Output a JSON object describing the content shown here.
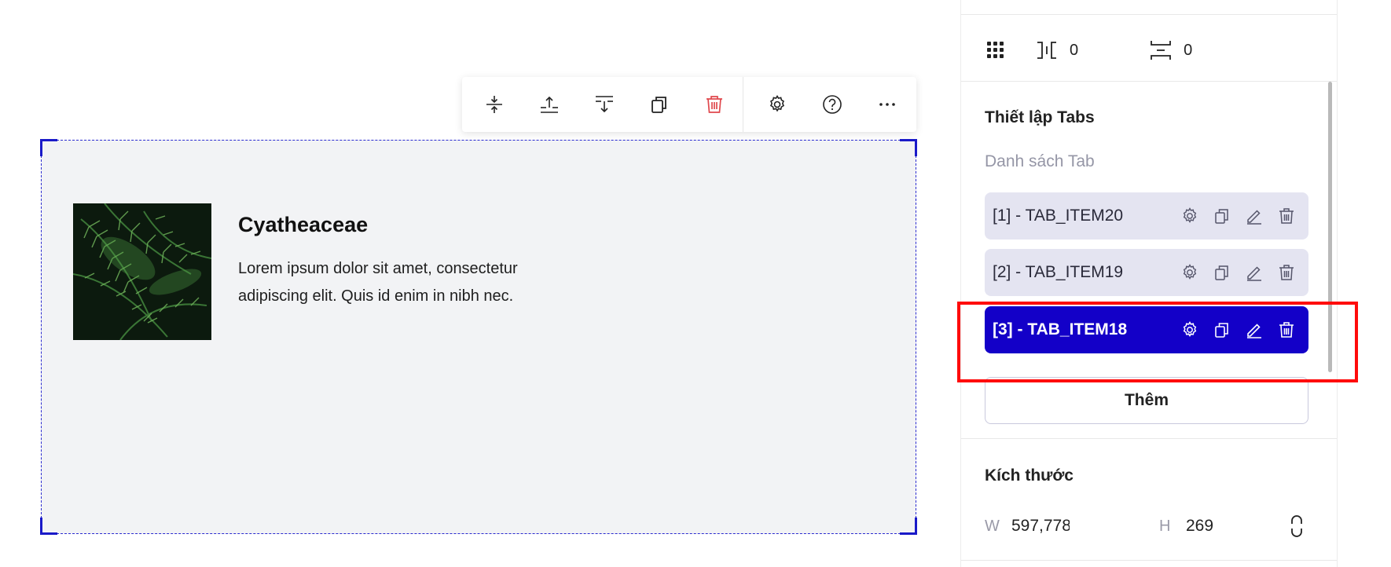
{
  "toolbar": {
    "left_buttons": [
      "move-icon",
      "insert-above-icon",
      "insert-below-icon",
      "duplicate-icon",
      "delete-icon"
    ],
    "right_buttons": [
      "settings-icon",
      "help-icon",
      "more-icon"
    ],
    "delete_color": "#e0484d"
  },
  "card": {
    "title": "Cyatheaceae",
    "text_line1": "Lorem ipsum dolor sit amet, consectetur",
    "text_line2": "adipiscing elit. Quis id enim in nibh nec."
  },
  "panel": {
    "spacing": {
      "gap_value": "0",
      "row_gap_value": "0"
    },
    "tabs_section_title": "Thiết lập Tabs",
    "tabs_list_label": "Danh sách Tab",
    "tabs": [
      {
        "label": "[1] - TAB_ITEM20",
        "active": false
      },
      {
        "label": "[2] - TAB_ITEM19",
        "active": false
      },
      {
        "label": "[3] - TAB_ITEM18",
        "active": true
      }
    ],
    "add_label": "Thêm",
    "size_title": "Kích thước",
    "size": {
      "w_label": "W",
      "w_value": "597,778",
      "h_label": "H",
      "h_value": "269"
    }
  },
  "colors": {
    "accent": "#1300c8",
    "tab_bg": "#e4e4f1",
    "highlight": "#ff0b0b",
    "canvas_bg": "#f2f3f5"
  }
}
